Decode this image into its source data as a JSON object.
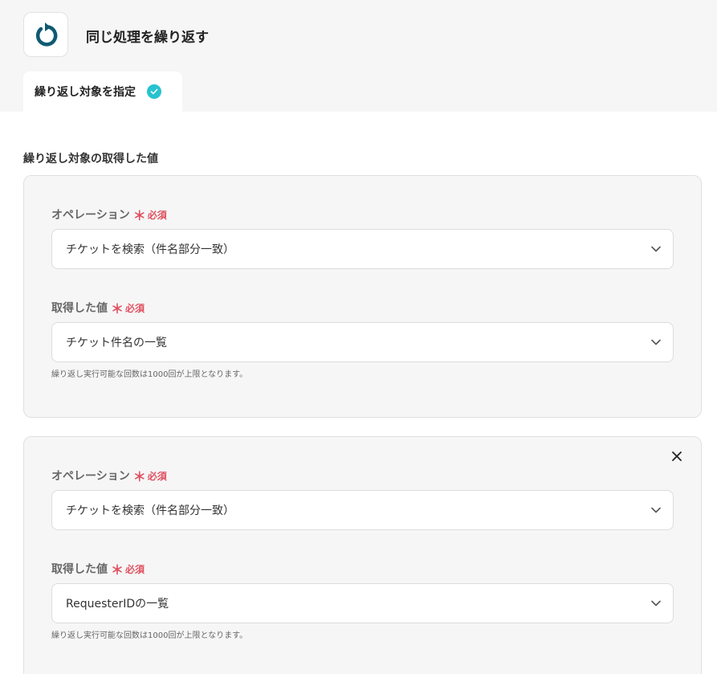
{
  "app": {
    "title": "同じ処理を繰り返す",
    "icon": "loop-icon",
    "accent_color": "#0f5a73"
  },
  "tab": {
    "label": "繰り返し対象を指定",
    "status_icon": "check-circle-icon",
    "status_color": "#27c3d0"
  },
  "section": {
    "title": "繰り返し対象の取得した値"
  },
  "required_mark": "＊",
  "required_text": "必須",
  "cards": [
    {
      "operation_label": "オペレーション",
      "operation_value": "チケットを検索（件名部分一致）",
      "value_label": "取得した値",
      "value_value": "チケット件名の一覧",
      "hint": "繰り返し実行可能な回数は1000回が上限となります。"
    },
    {
      "operation_label": "オペレーション",
      "operation_value": "チケットを検索（件名部分一致）",
      "value_label": "取得した値",
      "value_value": "RequesterIDの一覧",
      "hint": "繰り返し実行可能な回数は1000回が上限となります。",
      "close_icon": "close-icon"
    }
  ]
}
